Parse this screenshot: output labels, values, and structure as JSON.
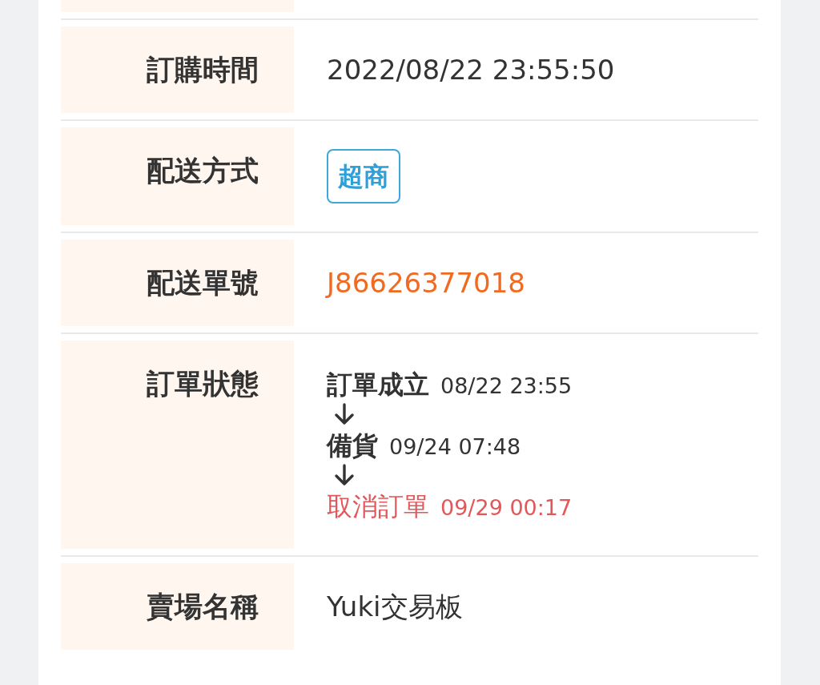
{
  "rows": [
    {
      "kind": "text",
      "label": "訂購時間",
      "value": "2022/08/22 23:55:50"
    },
    {
      "kind": "tag",
      "label": "配送方式",
      "value": "超商"
    },
    {
      "kind": "link",
      "label": "配送單號",
      "value": "J86626377018"
    },
    {
      "kind": "timeline",
      "label": "訂單狀態",
      "steps": [
        {
          "kind": "normal",
          "label": "訂單成立",
          "time": "08/22 23:55"
        },
        {
          "kind": "normal",
          "label": "備貨",
          "time": "09/24 07:48"
        },
        {
          "kind": "cancelled",
          "label": "取消訂單",
          "time": "09/29 00:17"
        }
      ]
    },
    {
      "kind": "text",
      "label": "賣場名稱",
      "value": "Yuki交易板"
    }
  ]
}
